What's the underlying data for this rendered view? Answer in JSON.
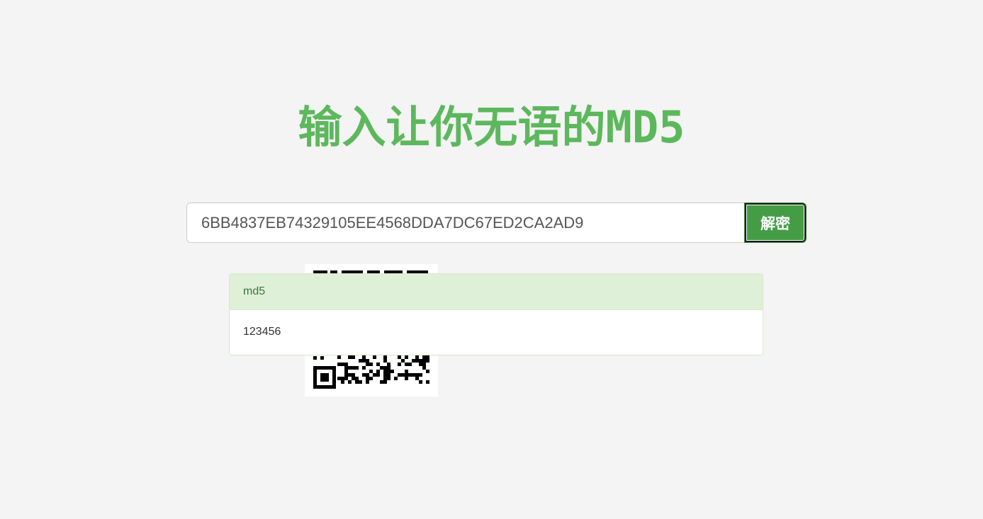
{
  "header": {
    "title": "输入让你无语的MD5"
  },
  "search": {
    "value": "6BB4837EB74329105EE4568DDA7DC67ED2CA2AD9",
    "placeholder": "",
    "decrypt_label": "解密"
  },
  "result": {
    "type_label": "md5",
    "plaintext": "123456"
  },
  "qr_code": {
    "icon": "qr-code"
  },
  "colors": {
    "accent": "#5cb85c",
    "button": "#449d44",
    "panel_heading_bg": "#dff0d8",
    "panel_heading_text": "#3c763d",
    "page_bg": "#f4f4f4"
  }
}
